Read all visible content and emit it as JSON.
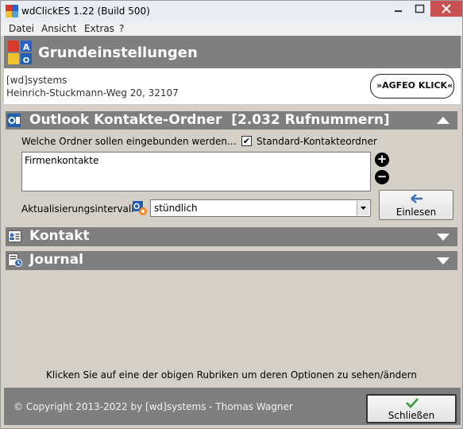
{
  "window": {
    "title": "wdClickES 1.22 (Build 500)"
  },
  "menu": {
    "items": [
      "Datei",
      "Ansicht",
      "Extras",
      "?"
    ]
  },
  "header": {
    "title": "Grundeinstellungen"
  },
  "info": {
    "company": "[wd]systems",
    "address": "Heinrich-Stuckmann-Weg 20, 32107",
    "logo_text": "»AGFEO KLICK«"
  },
  "sections": {
    "outlook": {
      "title": "Outlook Kontakte-Ordner  [2.032 Rufnummern]",
      "prompt": "Welche Ordner sollen eingebunden werden...",
      "checkbox_label": "Standard-Kontakteordner",
      "checkbox_checked": true,
      "folders": [
        "Firmenkontakte"
      ],
      "interval_label": "Aktualisierungsintervall",
      "interval_value": "stündlich",
      "load_button": "Einlesen"
    },
    "kontakt": {
      "title": "Kontakt"
    },
    "journal": {
      "title": "Journal"
    }
  },
  "hint": "Klicken Sie auf eine der obigen Rubriken um deren Optionen zu sehen/ändern",
  "footer": {
    "copyright": "© Copyright 2013-2022 by [wd]systems - Thomas Wagner",
    "close_button": "Schließen"
  },
  "colors": {
    "section_bg": "#7f7f7f",
    "panel_bg": "#d4d0c8",
    "accent_blue": "#1f5fb4",
    "check_green": "#3a9a3a"
  }
}
